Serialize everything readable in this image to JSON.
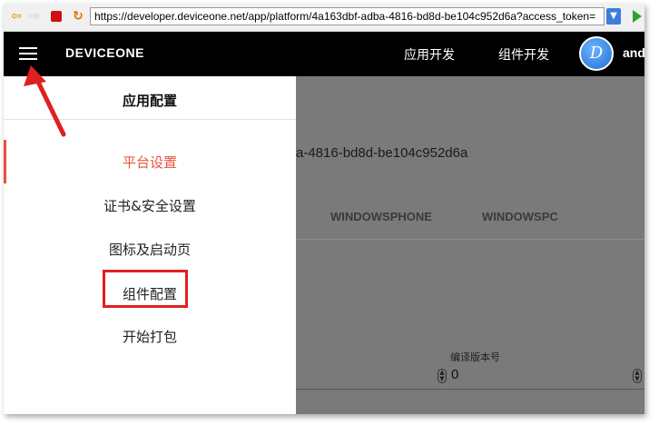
{
  "browser": {
    "url": "https://developer.deviceone.net/app/platform/4a163dbf-adba-4816-bd8d-be104c952d6a?access_token="
  },
  "header": {
    "brand": "DEVICEONE",
    "nav": [
      "应用开发",
      "组件开发"
    ],
    "user_name": "and"
  },
  "drawer": {
    "title": "应用配置",
    "items": [
      {
        "label": "平台设置",
        "active": true
      },
      {
        "label": "证书&安全设置",
        "active": false
      },
      {
        "label": "图标及启动页",
        "active": false
      },
      {
        "label": "组件配置",
        "active": false
      },
      {
        "label": "开始打包",
        "active": false
      }
    ],
    "accent_color": "#e8533a"
  },
  "main": {
    "app_id_fragment": "a-4816-bd8d-be104c952d6a",
    "tabs": [
      "WINDOWSPHONE",
      "WINDOWSPC"
    ],
    "version_label": "编译版本号",
    "version_value": "0"
  },
  "annotation": {
    "highlight_color": "#e02020"
  }
}
